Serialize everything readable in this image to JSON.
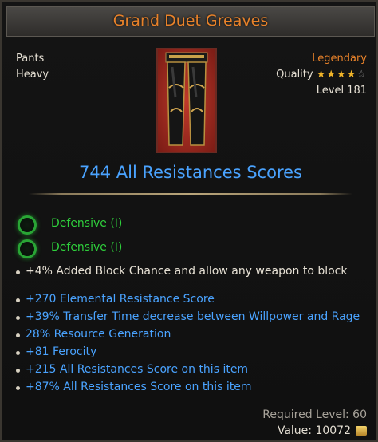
{
  "item": {
    "name": "Grand Duet Greaves",
    "slot": "Pants",
    "weight": "Heavy",
    "rarity": "Legendary",
    "quality_label": "Quality",
    "quality_stars": 4,
    "quality_max": 5,
    "level": "Level 181",
    "main_stat": "744 All Resistances Scores"
  },
  "sockets": [
    {
      "label": "Defensive (I)"
    },
    {
      "label": "Defensive (I)"
    }
  ],
  "implicit": "+4% Added Block Chance and allow any weapon to block",
  "affixes": [
    "+270 Elemental Resistance Score",
    "+39% Transfer Time decrease between Willpower and Rage",
    "28% Resource Generation",
    "+81 Ferocity",
    "+215 All Resistances Score on this item",
    "+87% All Resistances Score on this item"
  ],
  "footer": {
    "required_level": "Required Level: 60",
    "value": "Value: 10072"
  },
  "colors": {
    "title": "#e8822a",
    "main_stat": "#4aa3ff",
    "socket": "#2fd13c",
    "affix": "#4aa3ff",
    "stars": "#f0b429"
  },
  "icons": {
    "item": "greaves-icon",
    "socket": "gem-socket-icon",
    "currency": "coin-icon"
  }
}
